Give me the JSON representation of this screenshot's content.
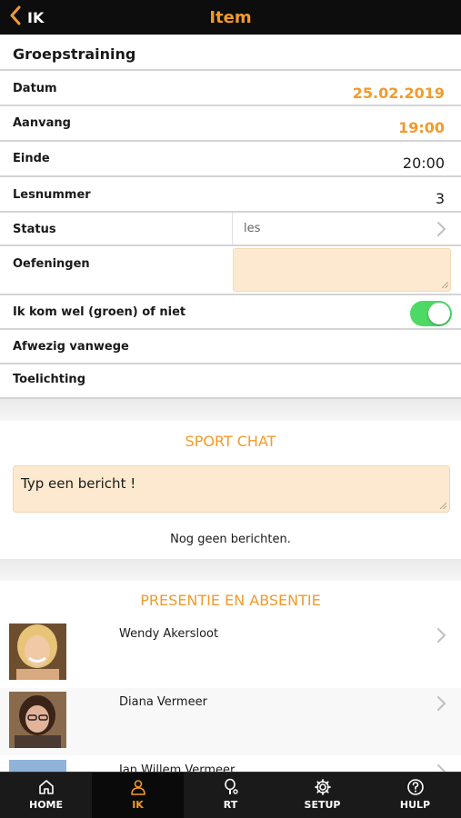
{
  "header": {
    "back_label": "IK",
    "title": "Item"
  },
  "item": {
    "title": "Groepstraining",
    "fields": {
      "datum": {
        "label": "Datum",
        "value": "25.02.2019"
      },
      "aanvang": {
        "label": "Aanvang",
        "value": "19:00"
      },
      "einde": {
        "label": "Einde",
        "value": "20:00"
      },
      "lesnummer": {
        "label": "Lesnummer",
        "value": "3"
      },
      "status": {
        "label": "Status",
        "value": "les"
      },
      "oefeningen": {
        "label": "Oefeningen",
        "value": ""
      },
      "attendance_toggle": {
        "label": "Ik kom wel (groen) of niet",
        "on": true
      },
      "afwezig": {
        "label": "Afwezig vanwege"
      },
      "toelichting": {
        "label": "Toelichting"
      }
    }
  },
  "chat": {
    "title": "SPORT CHAT",
    "placeholder": "Typ een bericht !",
    "empty_text": "Nog geen berichten."
  },
  "attendance": {
    "title": "PRESENTIE EN ABSENTIE",
    "people": [
      {
        "name": "Wendy Akersloot"
      },
      {
        "name": "Diana Vermeer"
      },
      {
        "name": "Jan Willem Vermeer"
      }
    ]
  },
  "tabs": [
    {
      "label": "HOME",
      "icon": "home-icon",
      "active": false
    },
    {
      "label": "IK",
      "icon": "person-icon",
      "active": true
    },
    {
      "label": "RT",
      "icon": "racket-icon",
      "active": false
    },
    {
      "label": "SETUP",
      "icon": "gear-icon",
      "active": false
    },
    {
      "label": "HULP",
      "icon": "help-icon",
      "active": false
    }
  ],
  "colors": {
    "accent": "#f39a2b",
    "header_bg": "#0d0d0d",
    "toggle_on": "#4cd964",
    "input_bg": "#fde9cf"
  }
}
